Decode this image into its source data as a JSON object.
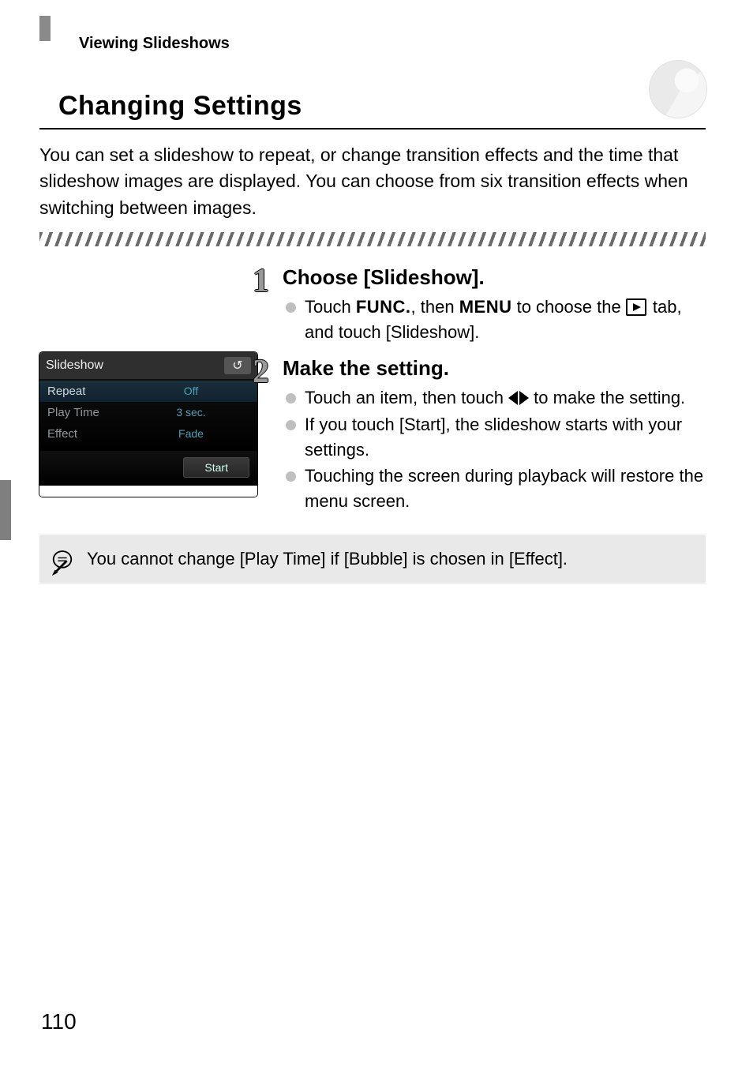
{
  "running_head": "Viewing Slideshows",
  "section_heading": "Changing Settings",
  "lead": "You can set a slideshow to repeat, or change transition effects and the time that slideshow images are displayed. You can choose from six transition effects when switching between images.",
  "steps": [
    {
      "num": "1",
      "title": "Choose [Slideshow].",
      "bullets": [
        {
          "pre": "Touch ",
          "word1": "FUNC.",
          "mid": ", then ",
          "word2": "MENU",
          "post": " to choose the "
        },
        {
          "tab_tail": " tab, and touch [Slideshow]."
        }
      ]
    },
    {
      "num": "2",
      "title": "Make the setting.",
      "bullets_plain": [
        {
          "pre": "Touch an item, then touch ",
          "post": " to make the setting."
        },
        "If you touch [Start], the slideshow starts with your settings.",
        "Touching the screen during playback will restore the menu screen."
      ]
    }
  ],
  "camera": {
    "title": "Slideshow",
    "back_glyph": "↺",
    "rows": [
      {
        "label": "Repeat",
        "value": "Off",
        "selected": true
      },
      {
        "label": "Play Time",
        "value": "3 sec.",
        "selected": false
      },
      {
        "label": "Effect",
        "value": "Fade",
        "selected": false
      }
    ],
    "start": "Start"
  },
  "note": "You cannot change [Play Time] if [Bubble] is chosen in [Effect].",
  "page_number": "110"
}
